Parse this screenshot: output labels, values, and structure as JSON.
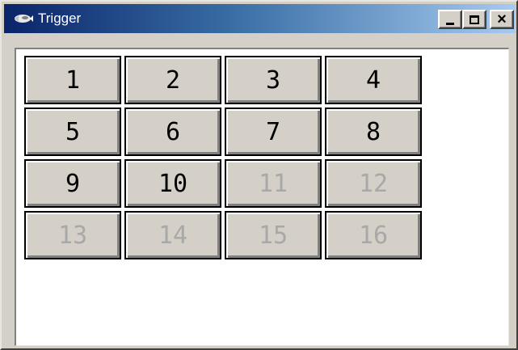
{
  "window": {
    "title": "Trigger",
    "close_label": "×"
  },
  "icons": {
    "app": "app-icon",
    "minimize": "minimize-icon",
    "maximize": "maximize-icon",
    "close": "close-icon"
  },
  "colors": {
    "titlebar_start": "#0a246a",
    "titlebar_end": "#a6caf0",
    "button_face": "#d4d0c8",
    "disabled_text": "#a8a8a8"
  },
  "buttons": [
    {
      "label": "1",
      "enabled": true
    },
    {
      "label": "2",
      "enabled": true
    },
    {
      "label": "3",
      "enabled": true
    },
    {
      "label": "4",
      "enabled": true
    },
    {
      "label": "5",
      "enabled": true
    },
    {
      "label": "6",
      "enabled": true
    },
    {
      "label": "7",
      "enabled": true
    },
    {
      "label": "8",
      "enabled": true
    },
    {
      "label": "9",
      "enabled": true
    },
    {
      "label": "10",
      "enabled": true
    },
    {
      "label": "11",
      "enabled": false
    },
    {
      "label": "12",
      "enabled": false
    },
    {
      "label": "13",
      "enabled": false
    },
    {
      "label": "14",
      "enabled": false
    },
    {
      "label": "15",
      "enabled": false
    },
    {
      "label": "16",
      "enabled": false
    }
  ]
}
